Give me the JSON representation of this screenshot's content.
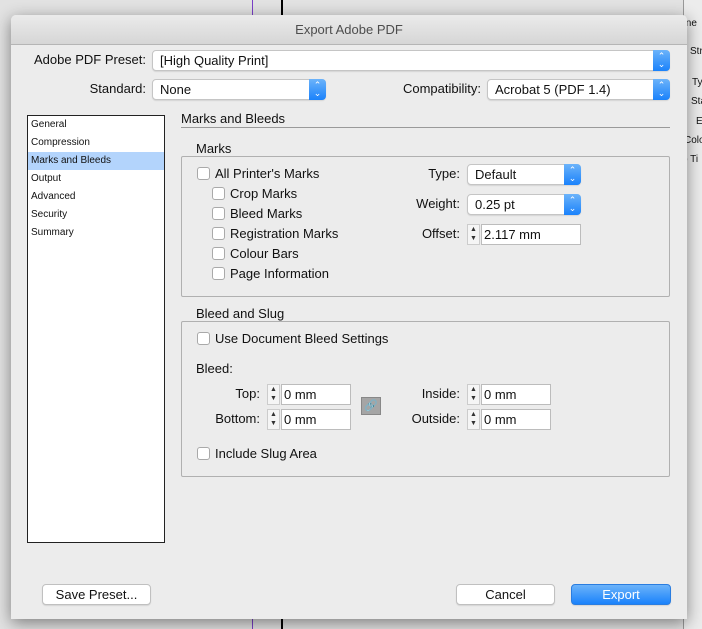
{
  "window": {
    "title": "Export Adobe PDF"
  },
  "background_panel": [
    "Line",
    "Stro",
    "Ty",
    "Sta",
    "E",
    "Colo",
    "p Ti"
  ],
  "preset": {
    "label": "Adobe PDF Preset:",
    "value": "[High Quality Print]"
  },
  "standard": {
    "label": "Standard:",
    "value": "None"
  },
  "compatibility": {
    "label": "Compatibility:",
    "value": "Acrobat 5 (PDF 1.4)"
  },
  "sidebar": {
    "items": [
      "General",
      "Compression",
      "Marks and Bleeds",
      "Output",
      "Advanced",
      "Security",
      "Summary"
    ],
    "selected": "Marks and Bleeds"
  },
  "section_title": "Marks and Bleeds",
  "marks": {
    "legend": "Marks",
    "all": {
      "label": "All Printer's Marks",
      "checked": false
    },
    "items": [
      {
        "label": "Crop Marks",
        "checked": false
      },
      {
        "label": "Bleed Marks",
        "checked": false
      },
      {
        "label": "Registration Marks",
        "checked": false
      },
      {
        "label": "Colour Bars",
        "checked": false
      },
      {
        "label": "Page Information",
        "checked": false
      }
    ],
    "type": {
      "label": "Type:",
      "value": "Default"
    },
    "weight": {
      "label": "Weight:",
      "value": "0.25 pt"
    },
    "offset": {
      "label": "Offset:",
      "value": "2.117 mm"
    }
  },
  "bleed_slug": {
    "legend": "Bleed and Slug",
    "use_doc": {
      "label": "Use Document Bleed Settings",
      "checked": false
    },
    "bleed_label": "Bleed:",
    "top": {
      "label": "Top:",
      "value": "0 mm"
    },
    "bottom": {
      "label": "Bottom:",
      "value": "0 mm"
    },
    "inside": {
      "label": "Inside:",
      "value": "0 mm"
    },
    "outside": {
      "label": "Outside:",
      "value": "0 mm"
    },
    "include_slug": {
      "label": "Include Slug Area",
      "checked": false
    }
  },
  "buttons": {
    "save_preset": "Save Preset...",
    "cancel": "Cancel",
    "export": "Export"
  },
  "colors": {
    "accent": "#1a82fb",
    "selection": "#b3d4fc"
  }
}
